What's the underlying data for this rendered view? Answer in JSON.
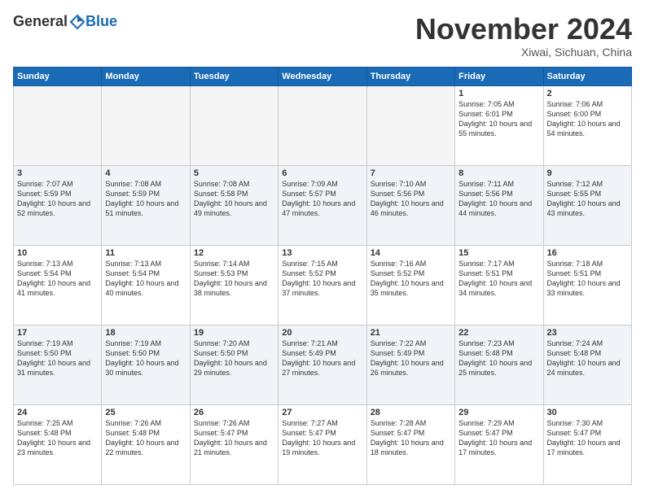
{
  "logo": {
    "general": "General",
    "blue": "Blue"
  },
  "header": {
    "month": "November 2024",
    "location": "Xiwai, Sichuan, China"
  },
  "days_of_week": [
    "Sunday",
    "Monday",
    "Tuesday",
    "Wednesday",
    "Thursday",
    "Friday",
    "Saturday"
  ],
  "weeks": [
    {
      "row_class": "row-odd",
      "days": [
        {
          "date": "",
          "empty": true
        },
        {
          "date": "",
          "empty": true
        },
        {
          "date": "",
          "empty": true
        },
        {
          "date": "",
          "empty": true
        },
        {
          "date": "",
          "empty": true
        },
        {
          "date": "1",
          "empty": false,
          "sunrise": "Sunrise: 7:05 AM",
          "sunset": "Sunset: 6:01 PM",
          "daylight": "Daylight: 10 hours and 55 minutes."
        },
        {
          "date": "2",
          "empty": false,
          "sunrise": "Sunrise: 7:06 AM",
          "sunset": "Sunset: 6:00 PM",
          "daylight": "Daylight: 10 hours and 54 minutes."
        }
      ]
    },
    {
      "row_class": "row-even",
      "days": [
        {
          "date": "3",
          "empty": false,
          "sunrise": "Sunrise: 7:07 AM",
          "sunset": "Sunset: 5:59 PM",
          "daylight": "Daylight: 10 hours and 52 minutes."
        },
        {
          "date": "4",
          "empty": false,
          "sunrise": "Sunrise: 7:08 AM",
          "sunset": "Sunset: 5:59 PM",
          "daylight": "Daylight: 10 hours and 51 minutes."
        },
        {
          "date": "5",
          "empty": false,
          "sunrise": "Sunrise: 7:08 AM",
          "sunset": "Sunset: 5:58 PM",
          "daylight": "Daylight: 10 hours and 49 minutes."
        },
        {
          "date": "6",
          "empty": false,
          "sunrise": "Sunrise: 7:09 AM",
          "sunset": "Sunset: 5:57 PM",
          "daylight": "Daylight: 10 hours and 47 minutes."
        },
        {
          "date": "7",
          "empty": false,
          "sunrise": "Sunrise: 7:10 AM",
          "sunset": "Sunset: 5:56 PM",
          "daylight": "Daylight: 10 hours and 46 minutes."
        },
        {
          "date": "8",
          "empty": false,
          "sunrise": "Sunrise: 7:11 AM",
          "sunset": "Sunset: 5:56 PM",
          "daylight": "Daylight: 10 hours and 44 minutes."
        },
        {
          "date": "9",
          "empty": false,
          "sunrise": "Sunrise: 7:12 AM",
          "sunset": "Sunset: 5:55 PM",
          "daylight": "Daylight: 10 hours and 43 minutes."
        }
      ]
    },
    {
      "row_class": "row-odd",
      "days": [
        {
          "date": "10",
          "empty": false,
          "sunrise": "Sunrise: 7:13 AM",
          "sunset": "Sunset: 5:54 PM",
          "daylight": "Daylight: 10 hours and 41 minutes."
        },
        {
          "date": "11",
          "empty": false,
          "sunrise": "Sunrise: 7:13 AM",
          "sunset": "Sunset: 5:54 PM",
          "daylight": "Daylight: 10 hours and 40 minutes."
        },
        {
          "date": "12",
          "empty": false,
          "sunrise": "Sunrise: 7:14 AM",
          "sunset": "Sunset: 5:53 PM",
          "daylight": "Daylight: 10 hours and 38 minutes."
        },
        {
          "date": "13",
          "empty": false,
          "sunrise": "Sunrise: 7:15 AM",
          "sunset": "Sunset: 5:52 PM",
          "daylight": "Daylight: 10 hours and 37 minutes."
        },
        {
          "date": "14",
          "empty": false,
          "sunrise": "Sunrise: 7:16 AM",
          "sunset": "Sunset: 5:52 PM",
          "daylight": "Daylight: 10 hours and 35 minutes."
        },
        {
          "date": "15",
          "empty": false,
          "sunrise": "Sunrise: 7:17 AM",
          "sunset": "Sunset: 5:51 PM",
          "daylight": "Daylight: 10 hours and 34 minutes."
        },
        {
          "date": "16",
          "empty": false,
          "sunrise": "Sunrise: 7:18 AM",
          "sunset": "Sunset: 5:51 PM",
          "daylight": "Daylight: 10 hours and 33 minutes."
        }
      ]
    },
    {
      "row_class": "row-even",
      "days": [
        {
          "date": "17",
          "empty": false,
          "sunrise": "Sunrise: 7:19 AM",
          "sunset": "Sunset: 5:50 PM",
          "daylight": "Daylight: 10 hours and 31 minutes."
        },
        {
          "date": "18",
          "empty": false,
          "sunrise": "Sunrise: 7:19 AM",
          "sunset": "Sunset: 5:50 PM",
          "daylight": "Daylight: 10 hours and 30 minutes."
        },
        {
          "date": "19",
          "empty": false,
          "sunrise": "Sunrise: 7:20 AM",
          "sunset": "Sunset: 5:50 PM",
          "daylight": "Daylight: 10 hours and 29 minutes."
        },
        {
          "date": "20",
          "empty": false,
          "sunrise": "Sunrise: 7:21 AM",
          "sunset": "Sunset: 5:49 PM",
          "daylight": "Daylight: 10 hours and 27 minutes."
        },
        {
          "date": "21",
          "empty": false,
          "sunrise": "Sunrise: 7:22 AM",
          "sunset": "Sunset: 5:49 PM",
          "daylight": "Daylight: 10 hours and 26 minutes."
        },
        {
          "date": "22",
          "empty": false,
          "sunrise": "Sunrise: 7:23 AM",
          "sunset": "Sunset: 5:48 PM",
          "daylight": "Daylight: 10 hours and 25 minutes."
        },
        {
          "date": "23",
          "empty": false,
          "sunrise": "Sunrise: 7:24 AM",
          "sunset": "Sunset: 5:48 PM",
          "daylight": "Daylight: 10 hours and 24 minutes."
        }
      ]
    },
    {
      "row_class": "row-odd",
      "days": [
        {
          "date": "24",
          "empty": false,
          "sunrise": "Sunrise: 7:25 AM",
          "sunset": "Sunset: 5:48 PM",
          "daylight": "Daylight: 10 hours and 23 minutes."
        },
        {
          "date": "25",
          "empty": false,
          "sunrise": "Sunrise: 7:26 AM",
          "sunset": "Sunset: 5:48 PM",
          "daylight": "Daylight: 10 hours and 22 minutes."
        },
        {
          "date": "26",
          "empty": false,
          "sunrise": "Sunrise: 7:26 AM",
          "sunset": "Sunset: 5:47 PM",
          "daylight": "Daylight: 10 hours and 21 minutes."
        },
        {
          "date": "27",
          "empty": false,
          "sunrise": "Sunrise: 7:27 AM",
          "sunset": "Sunset: 5:47 PM",
          "daylight": "Daylight: 10 hours and 19 minutes."
        },
        {
          "date": "28",
          "empty": false,
          "sunrise": "Sunrise: 7:28 AM",
          "sunset": "Sunset: 5:47 PM",
          "daylight": "Daylight: 10 hours and 18 minutes."
        },
        {
          "date": "29",
          "empty": false,
          "sunrise": "Sunrise: 7:29 AM",
          "sunset": "Sunset: 5:47 PM",
          "daylight": "Daylight: 10 hours and 17 minutes."
        },
        {
          "date": "30",
          "empty": false,
          "sunrise": "Sunrise: 7:30 AM",
          "sunset": "Sunset: 5:47 PM",
          "daylight": "Daylight: 10 hours and 17 minutes."
        }
      ]
    }
  ]
}
